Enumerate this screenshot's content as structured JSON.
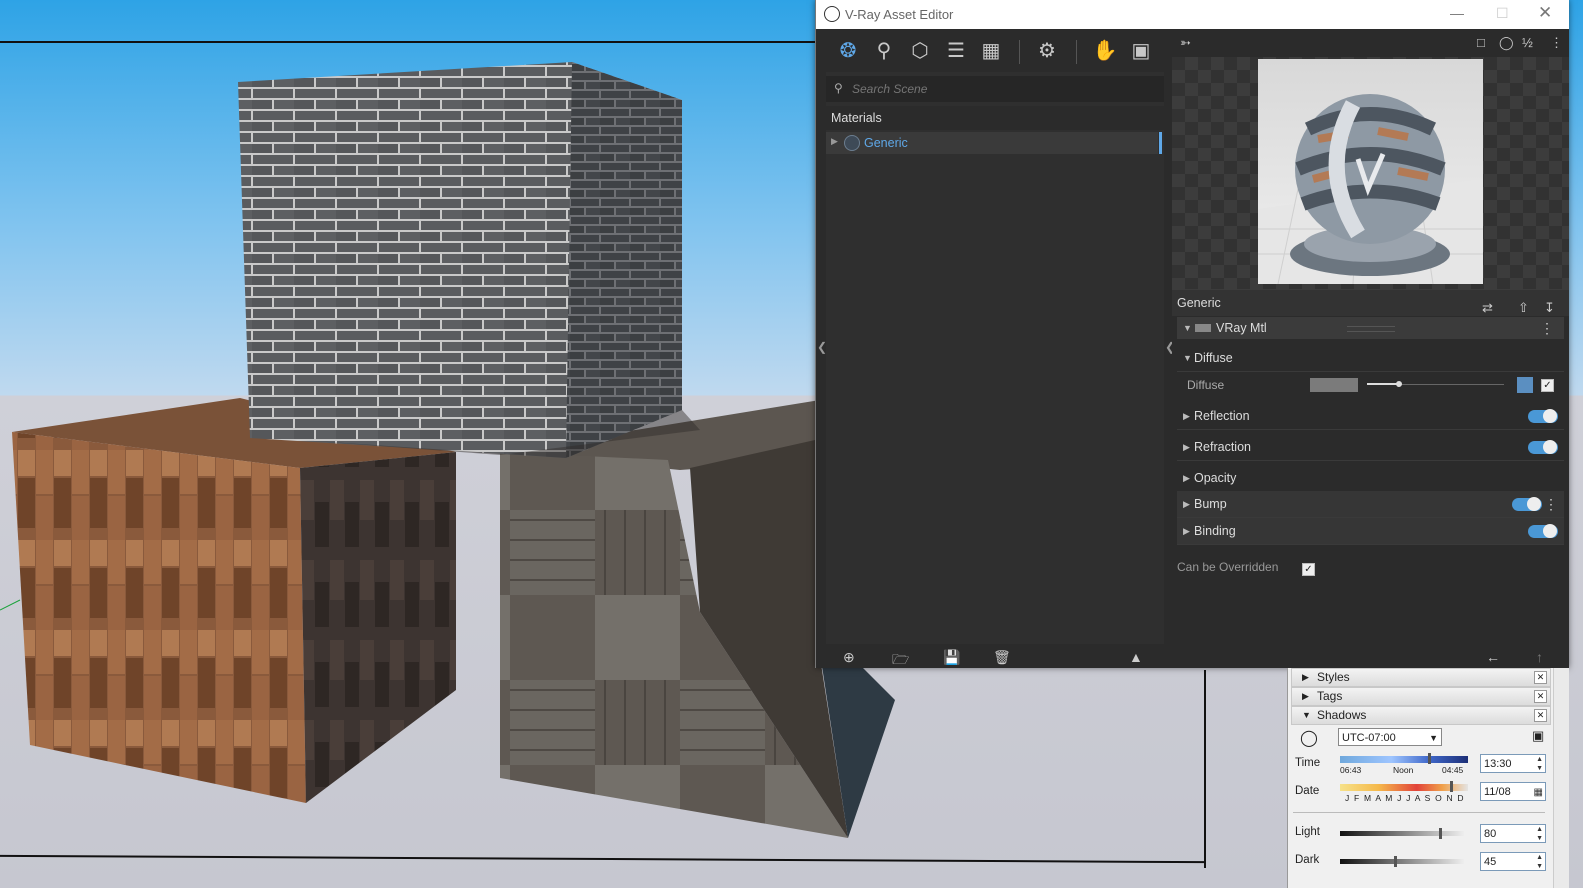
{
  "window": {
    "title": "V-Ray Asset Editor",
    "minimize_icon": "minimize-icon",
    "maximize_icon": "maximize-icon",
    "close_icon": "close-icon"
  },
  "toolbar": {
    "icons": [
      "materials-icon",
      "lights-icon",
      "geometry-icon",
      "layers-icon",
      "textures-icon",
      "settings-icon",
      "render-interactive-icon",
      "frame-buffer-icon"
    ]
  },
  "search": {
    "placeholder": "Search Scene"
  },
  "outliner": {
    "section_title": "Materials",
    "items": [
      {
        "label": "Generic"
      }
    ]
  },
  "properties": {
    "material_name": "Generic",
    "brdf_label": "VRay Mtl",
    "diffuse_header": "Diffuse",
    "diffuse_param": "Diffuse",
    "diffuse_color": "#7b7b7b",
    "rows": [
      {
        "label": "Reflection",
        "toggle": true
      },
      {
        "label": "Refraction",
        "toggle": true
      },
      {
        "label": "Opacity",
        "toggle": false
      },
      {
        "label": "Bump",
        "toggle": true
      },
      {
        "label": "Binding",
        "toggle": true
      }
    ],
    "override_label": "Can be Overridden",
    "override_checked": true
  },
  "tray": {
    "panels": [
      "Styles",
      "Tags",
      "Shadows"
    ],
    "timezone": "UTC-07:00",
    "time_label": "Time",
    "time_ticks": [
      "06:43",
      "Noon",
      "04:45"
    ],
    "time_value": "13:30",
    "date_label": "Date",
    "date_months": "J F M A M J J A S O N D",
    "date_value": "11/08",
    "light_label": "Light",
    "light_value": "80",
    "dark_label": "Dark",
    "dark_value": "45"
  },
  "colors": {
    "accent": "#5fa8e8",
    "toggle_on": "#4a98d6",
    "panel_bg": "#2b2b2b"
  }
}
